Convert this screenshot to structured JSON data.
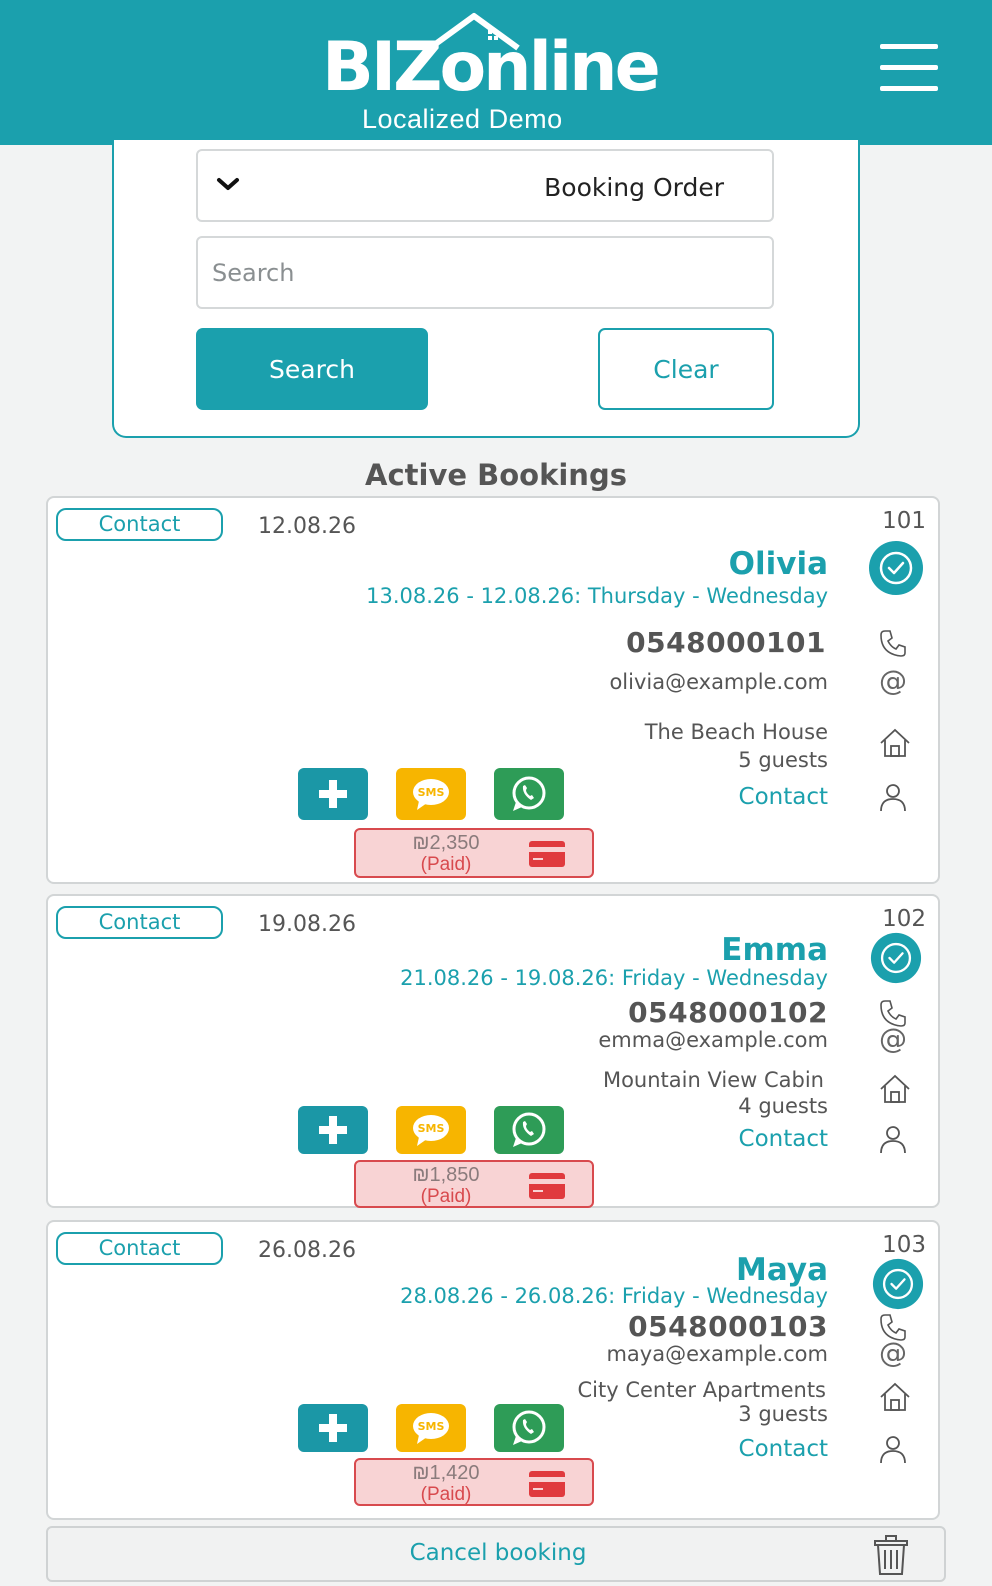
{
  "header": {
    "logo_main": "BIZonline",
    "logo_sub": "Localized Demo"
  },
  "filter": {
    "order_select_value": "Booking Order",
    "search_placeholder": "Search",
    "search_button": "Search",
    "clear_button": "Clear"
  },
  "section_title": "Active Bookings",
  "bookings": [
    {
      "contact_button": "Contact",
      "date": "12.08.26",
      "number": "101",
      "name": "Olivia",
      "range": "13.08.26 - 12.08.26: Thursday - Wednesday",
      "phone": "0548000101",
      "email": "olivia@example.com",
      "property": "The Beach House",
      "guests": "5 guests",
      "contact_link": "Contact",
      "amount": "₪2,350",
      "payment_status": "(Paid)"
    },
    {
      "contact_button": "Contact",
      "date": "19.08.26",
      "number": "102",
      "name": "Emma",
      "range": "21.08.26 - 19.08.26: Friday - Wednesday",
      "phone": "0548000102",
      "email": "emma@example.com",
      "property": "Mountain View Cabin",
      "guests": "4 guests",
      "contact_link": "Contact",
      "amount": "₪1,850",
      "payment_status": "(Paid)"
    },
    {
      "contact_button": "Contact",
      "date": "26.08.26",
      "number": "103",
      "name": "Maya",
      "range": "28.08.26 - 26.08.26: Friday - Wednesday",
      "phone": "0548000103",
      "email": "maya@example.com",
      "property": "City Center Apartments",
      "guests": "3 guests",
      "contact_link": "Contact",
      "amount": "₪1,420",
      "payment_status": "(Paid)"
    }
  ],
  "action_labels": {
    "sms": "SMS"
  },
  "footer": {
    "cancel_label": "Cancel booking"
  },
  "icons": [
    "menu-icon",
    "chevron-down-icon",
    "check-circle-icon",
    "phone-icon",
    "at-icon",
    "home-icon",
    "person-icon",
    "plus-icon",
    "sms-icon",
    "whatsapp-icon",
    "credit-card-icon",
    "trash-icon"
  ],
  "colors": {
    "brand": "#1ba0ad",
    "sms": "#f7b500",
    "whatsapp": "#2e9c57",
    "paid_bg": "#f8d3d4",
    "paid_border": "#d84a4e"
  }
}
